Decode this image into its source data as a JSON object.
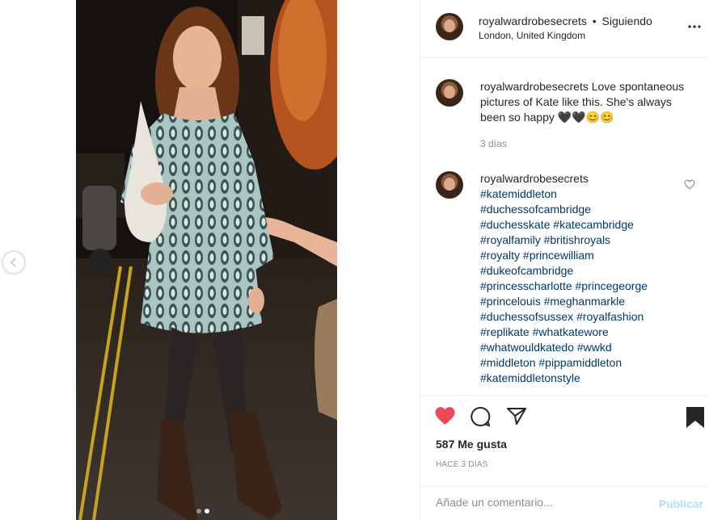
{
  "post": {
    "username": "royalwardrobesecrets",
    "separator": "•",
    "follow_status": "Siguiendo",
    "location": "London, United Kingdom",
    "more_icon": "more-options-icon"
  },
  "comments": [
    {
      "username": "royalwardrobesecrets",
      "text": "Love spontaneous pictures of Kate like this. She's always been so happy 🖤🖤😊😊",
      "time": "3 días"
    },
    {
      "username": "royalwardrobesecrets",
      "hashtags": [
        "#katemiddleton",
        "#duchessofcambridge",
        "#duchesskate #katecambridge",
        "#royalfamily #britishroyals",
        "#royalty #princewilliam",
        "#dukeofcambridge",
        "#princesscharlotte #princegeorge",
        "#princelouis #meghanmarkle",
        "#duchessofsussex #royalfashion",
        "#replikate #whatkatewore",
        "#whatwouldkatedo #wwkd",
        "#middleton #pippamiddleton",
        "#katemiddletonstyle"
      ]
    }
  ],
  "actions": {
    "likes": "587 Me gusta",
    "time_ago": "HACE 3 DÍAS",
    "comment_placeholder": "Añade un comentario...",
    "publish_label": "Publicar"
  },
  "colors": {
    "like_red": "#ed4956",
    "link_blue": "#00376b",
    "publish_disabled": "#b2dffc",
    "muted": "#8e8e8e"
  },
  "icons": [
    "heart-filled-icon",
    "comment-icon",
    "share-icon",
    "bookmark-icon",
    "heart-outline-icon",
    "chevron-left-icon"
  ]
}
